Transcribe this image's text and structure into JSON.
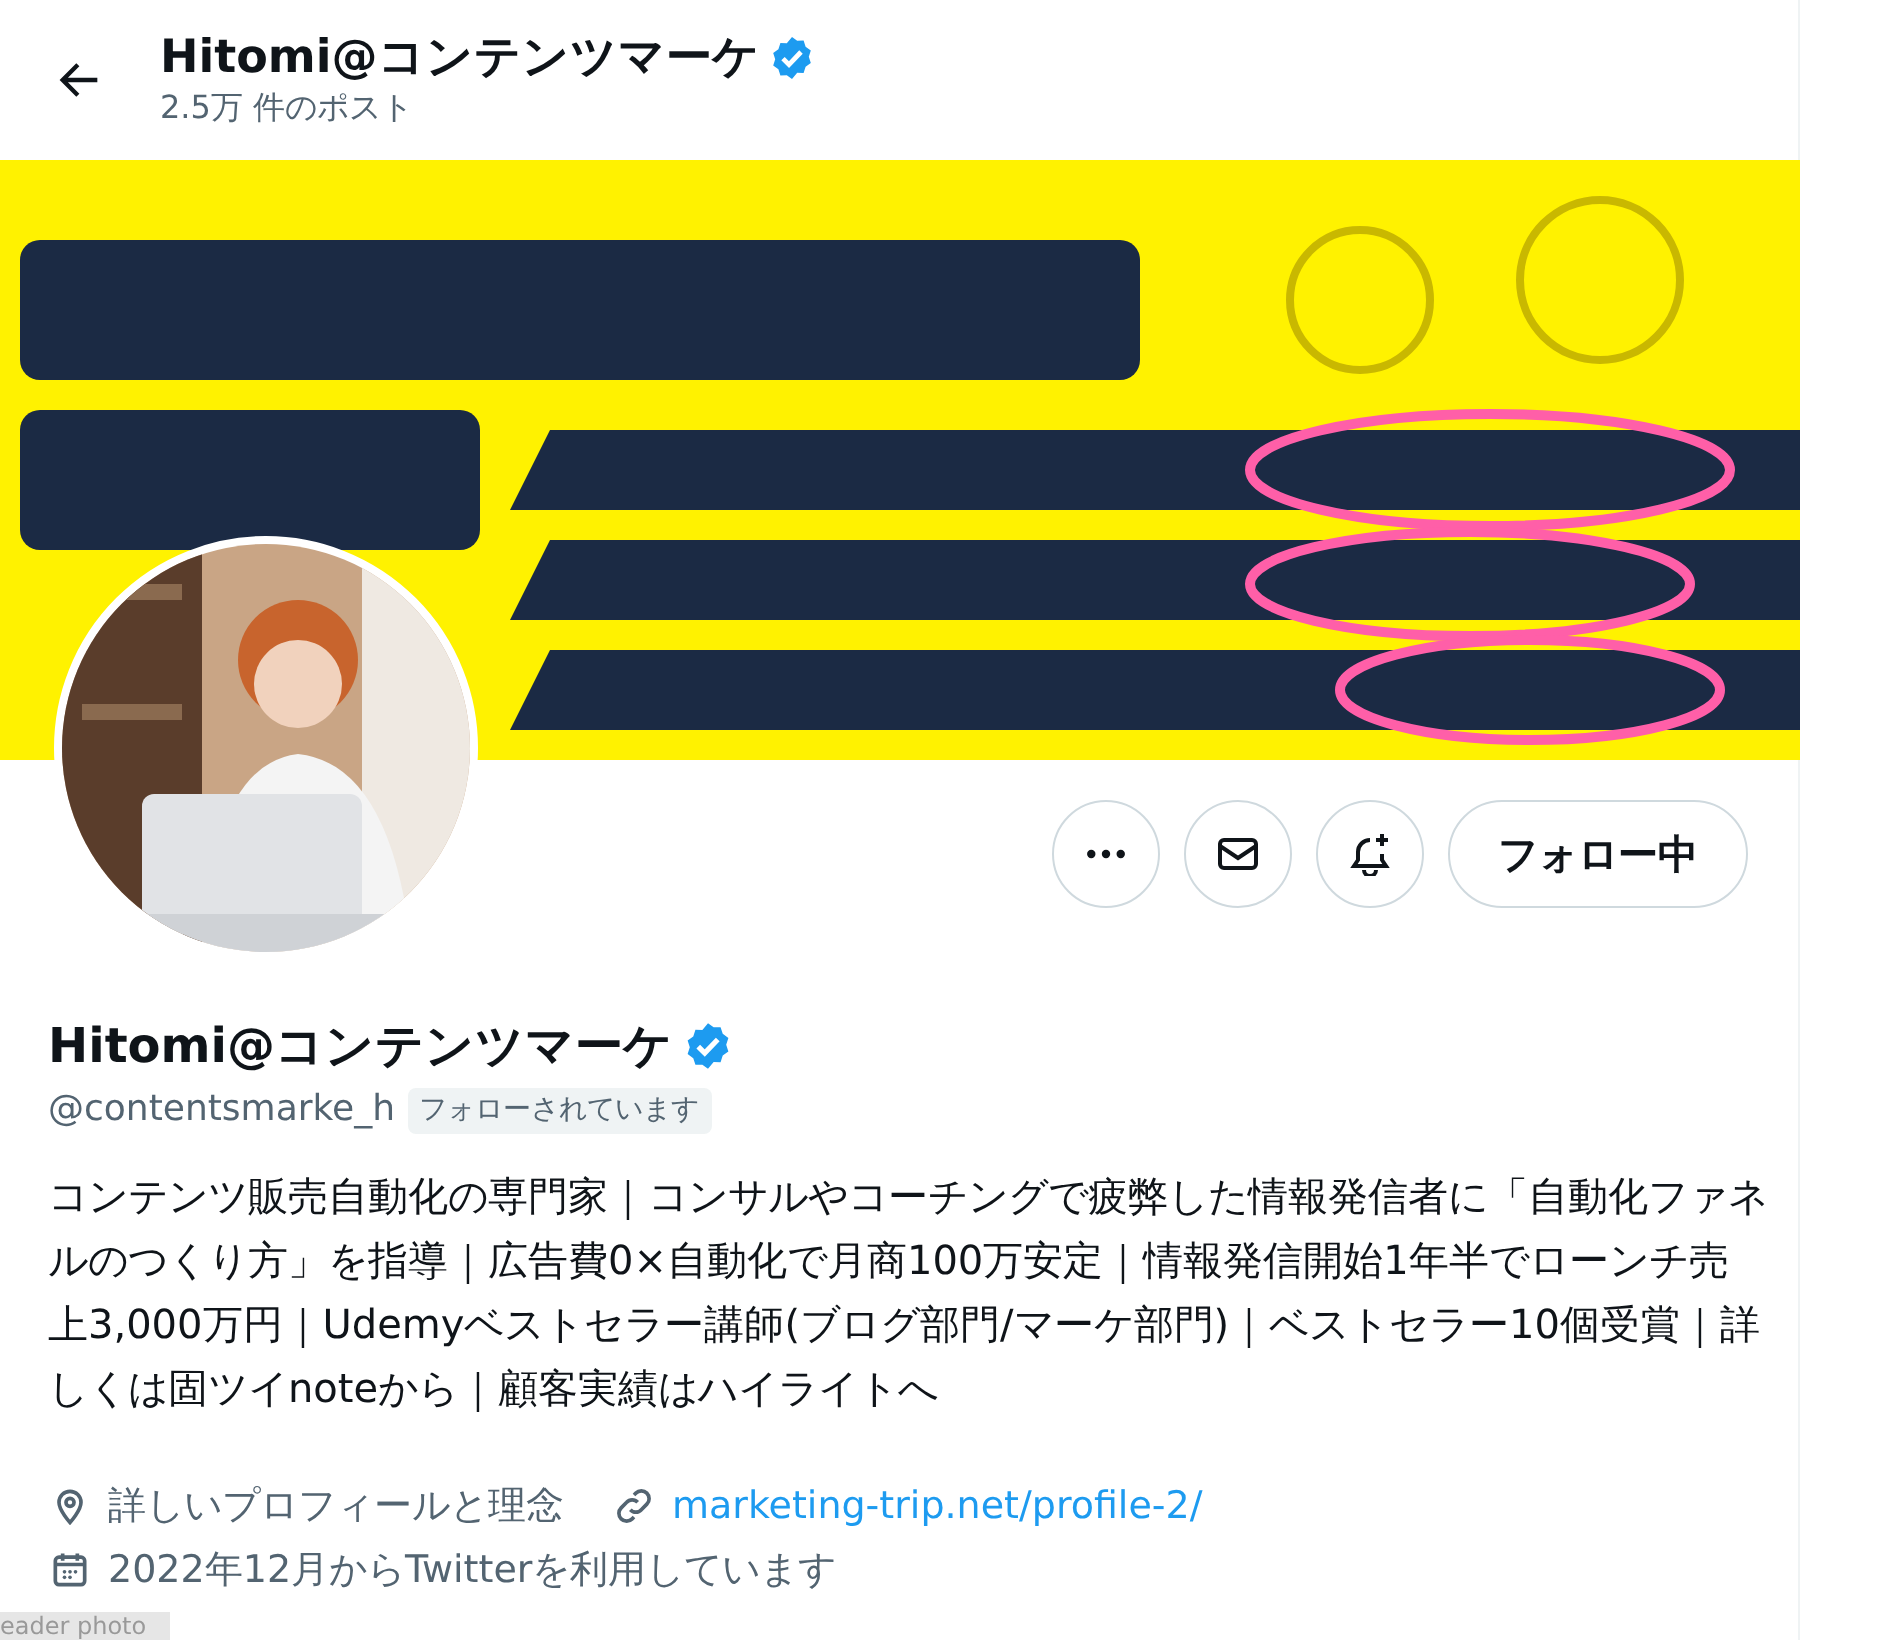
{
  "header": {
    "title": "Hitomi@コンテンツマーケ",
    "verified": true,
    "post_count": "2.5万 件のポスト"
  },
  "actions": [
    {
      "kind": "more"
    },
    {
      "kind": "message"
    },
    {
      "kind": "notify"
    },
    {
      "kind": "follow",
      "label": "フォロー中"
    }
  ],
  "profile": {
    "name": "Hitomi@コンテンツマーケ",
    "verified": true,
    "handle": "@contentsmarke_h",
    "follows_you": "フォローされています",
    "bio": "コンテンツ販売自動化の専門家｜コンサルやコーチングで疲弊した情報発信者に「自動化ファネルのつくり方」を指導｜広告費0×自動化で月商100万安定｜情報発信開始1年半でローンチ売上3,000万円｜Udemyベストセラー講師(ブログ部門/マーケ部門)｜ベストセラー10個受賞｜詳しくは固ツイnoteから｜顧客実績はハイライトへ",
    "meta": [
      {
        "kind": "location",
        "text": "詳しいプロフィールと理念"
      },
      {
        "kind": "link",
        "text": "marketing-trip.net/profile-2/"
      },
      {
        "kind": "joined",
        "text": "2022年12月からTwitterを利用しています"
      }
    ]
  },
  "tooltip": "eader photo"
}
